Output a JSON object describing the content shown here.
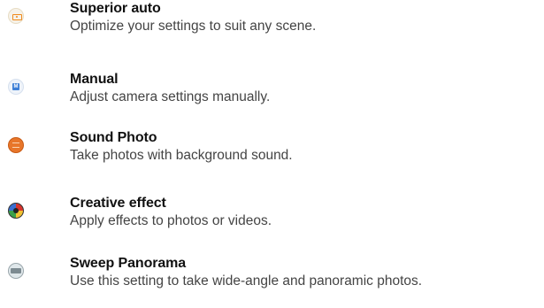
{
  "modes": [
    {
      "title": "Superior auto",
      "description": "Optimize your settings to suit any scene.",
      "icon": "superior-auto-icon",
      "icon_color": "#f08a1c"
    },
    {
      "title": "Manual",
      "description": "Adjust camera settings manually.",
      "icon": "manual-icon",
      "icon_color": "#3d7fd6",
      "icon_glyph": "M"
    },
    {
      "title": "Sound Photo",
      "description": "Take photos with background sound.",
      "icon": "sound-photo-icon",
      "icon_color": "#e8762a"
    },
    {
      "title": "Creative effect",
      "description": "Apply effects to photos or videos.",
      "icon": "creative-effect-icon",
      "icon_color": "#d8342c"
    },
    {
      "title": "Sweep Panorama",
      "description": "Use this setting to take wide-angle and panoramic photos.",
      "icon": "sweep-panorama-icon",
      "icon_color": "#7d8b91"
    }
  ]
}
